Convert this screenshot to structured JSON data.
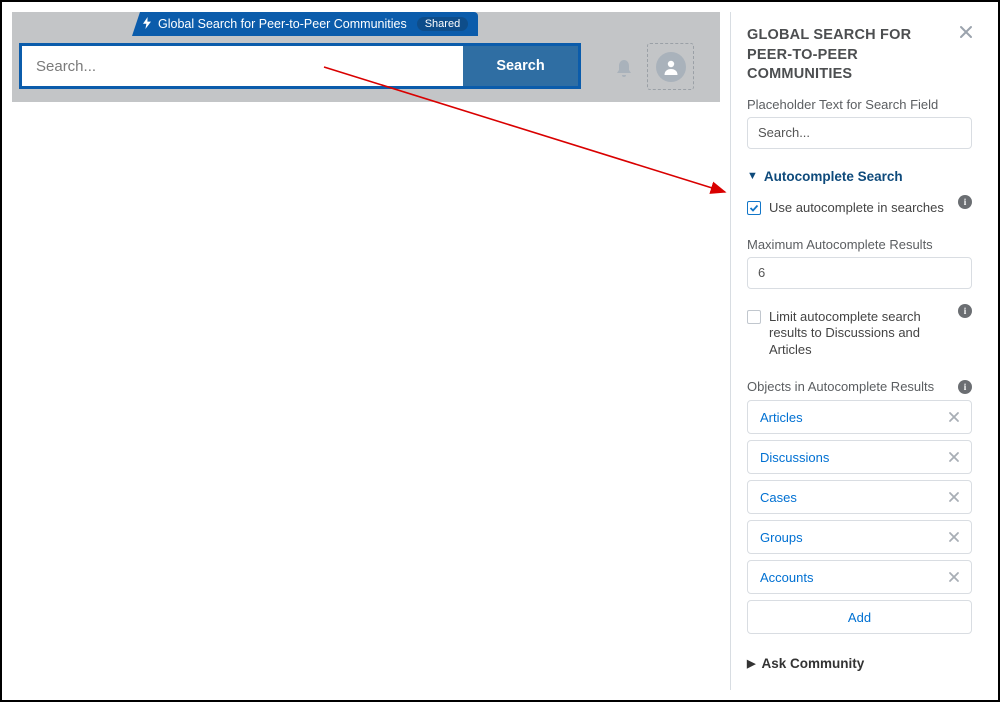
{
  "preview": {
    "tab_label": "Global Search for Peer-to-Peer Communities",
    "shared_label": "Shared",
    "search_placeholder": "Search...",
    "search_button": "Search"
  },
  "panel": {
    "title": "GLOBAL SEARCH FOR PEER-TO-PEER COMMUNITIES",
    "placeholder_field_label": "Placeholder Text for Search Field",
    "placeholder_field_value": "Search...",
    "section_autocomplete": {
      "title": "Autocomplete Search",
      "use_autocomplete_label": "Use autocomplete in searches",
      "use_autocomplete_checked": true,
      "max_results_label": "Maximum Autocomplete Results",
      "max_results_value": "6",
      "limit_label": "Limit autocomplete search results to Discussions and Articles",
      "limit_checked": false,
      "objects_label": "Objects in Autocomplete Results",
      "objects": [
        "Articles",
        "Discussions",
        "Cases",
        "Groups",
        "Accounts"
      ],
      "add_label": "Add"
    },
    "section_ask": {
      "title": "Ask Community"
    }
  }
}
